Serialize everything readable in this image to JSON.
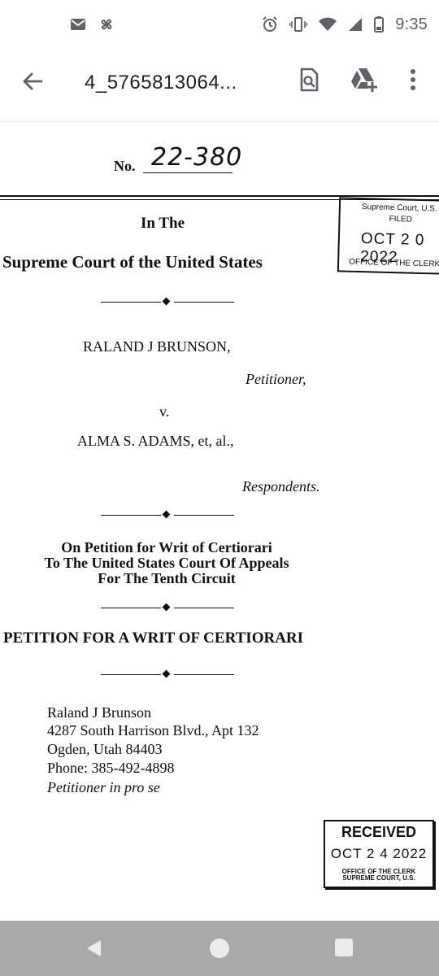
{
  "status_bar": {
    "time": "9:35",
    "left_icons": [
      "mail-icon",
      "pinwheel-icon"
    ],
    "right_icons": [
      "alarm-icon",
      "vibrate-icon",
      "wifi-icon",
      "signal-icon",
      "battery-icon"
    ]
  },
  "app_bar": {
    "file_name": "4_5765813064...",
    "icons": [
      "back-arrow-icon",
      "search-document-icon",
      "drive-add-icon",
      "more-vert-icon"
    ]
  },
  "document": {
    "docket_label": "No.",
    "docket_number": "22-380",
    "court_intro": "In The",
    "court_name": "Supreme Court of the United States",
    "petitioner_name": "RALAND J BRUNSON,",
    "petitioner_role": "Petitioner,",
    "versus": "v.",
    "respondent_name": "ALMA S. ADAMS, et, al.,",
    "respondent_role": "Respondents.",
    "writ_line1": "On Petition for Writ of Certiorari",
    "writ_line2": "To The United States Court Of Appeals",
    "writ_line3": "For The Tenth Circuit",
    "petition_title": "PETITION FOR A WRIT OF CERTIORARI",
    "contact_name": "Raland J Brunson",
    "contact_address": "4287 South Harrison Blvd., Apt 132",
    "contact_city": "Ogden, Utah 84403",
    "contact_phone": "Phone:  385-492-4898",
    "contact_role": "Petitioner in pro se",
    "stamp_filed": {
      "line1": "Supreme Court, U.S.",
      "line2": "FILED",
      "date": "OCT 2 0 2022",
      "office": "OFFICE OF THE CLERK"
    },
    "stamp_received": {
      "title": "RECEIVED",
      "date": "OCT 2 4  2022",
      "office_line1": "OFFICE OF THE CLERK",
      "office_line2": "SUPREME COURT, U.S."
    }
  },
  "nav_bar": {
    "icons": [
      "nav-back-icon",
      "nav-home-icon",
      "nav-recents-icon"
    ]
  },
  "colors": {
    "status_icon": "#5f6368",
    "text_primary": "#202124",
    "nav_bar_bg": "#a9a9a9"
  }
}
